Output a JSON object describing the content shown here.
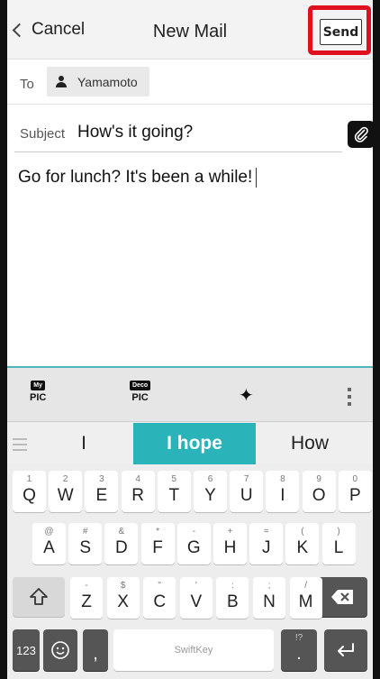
{
  "header": {
    "cancel_label": "Cancel",
    "title": "New Mail",
    "send_label": "Send",
    "highlight_color": "#e0101f"
  },
  "recipient": {
    "to_label": "To",
    "name": "Yamamoto"
  },
  "subject": {
    "label": "Subject",
    "value": "How's it going?"
  },
  "body": {
    "text": "Go for lunch? It's been a while!"
  },
  "keyboard": {
    "toolbar": {
      "my_pic_badge": "My",
      "my_pic_label": "PIC",
      "deco_pic_badge": "Deco",
      "deco_pic_label": "PIC",
      "sparkle_icon": "sparkle-icon",
      "more_icon": "more-vertical-icon"
    },
    "suggestions": [
      "I",
      "I hope",
      "How"
    ],
    "accent_color": "#2ab3b8",
    "row1": [
      {
        "sub": "1",
        "main": "Q"
      },
      {
        "sub": "2",
        "main": "W"
      },
      {
        "sub": "3",
        "main": "E"
      },
      {
        "sub": "4",
        "main": "R"
      },
      {
        "sub": "5",
        "main": "T"
      },
      {
        "sub": "6",
        "main": "Y"
      },
      {
        "sub": "7",
        "main": "U"
      },
      {
        "sub": "8",
        "main": "I"
      },
      {
        "sub": "9",
        "main": "O"
      },
      {
        "sub": "0",
        "main": "P"
      }
    ],
    "row2": [
      {
        "sub": "@",
        "main": "A"
      },
      {
        "sub": "#",
        "main": "S"
      },
      {
        "sub": "&",
        "main": "D"
      },
      {
        "sub": "*",
        "main": "F"
      },
      {
        "sub": "-",
        "main": "G"
      },
      {
        "sub": "+",
        "main": "H"
      },
      {
        "sub": "=",
        "main": "J"
      },
      {
        "sub": "(",
        "main": "K"
      },
      {
        "sub": ")",
        "main": "L"
      }
    ],
    "row3": [
      {
        "sub": "-",
        "main": "Z"
      },
      {
        "sub": "$",
        "main": "X"
      },
      {
        "sub": "\"",
        "main": "C"
      },
      {
        "sub": "'",
        "main": "V"
      },
      {
        "sub": ":",
        "main": "B"
      },
      {
        "sub": ";",
        "main": "N"
      },
      {
        "sub": "/",
        "main": "M"
      }
    ],
    "bottom": {
      "numbers_label": "123",
      "comma_label": ",",
      "space_label": "SwiftKey",
      "period_sub": "!?",
      "period_label": "."
    }
  }
}
